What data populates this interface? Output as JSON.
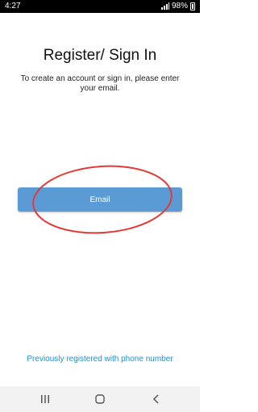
{
  "status_bar": {
    "time": "4:27",
    "battery": "98%"
  },
  "main": {
    "title": "Register/ Sign In",
    "subtitle": "To create an account or sign in, please enter your email.",
    "email_button_label": "Email",
    "phone_link_label": "Previously registered with phone number"
  },
  "colors": {
    "button": "#5b9bd5",
    "link": "#1e8fd0",
    "annotation": "#e53935"
  },
  "nav_bar": {
    "icons": [
      "recent-apps-icon",
      "home-icon",
      "back-icon"
    ]
  }
}
